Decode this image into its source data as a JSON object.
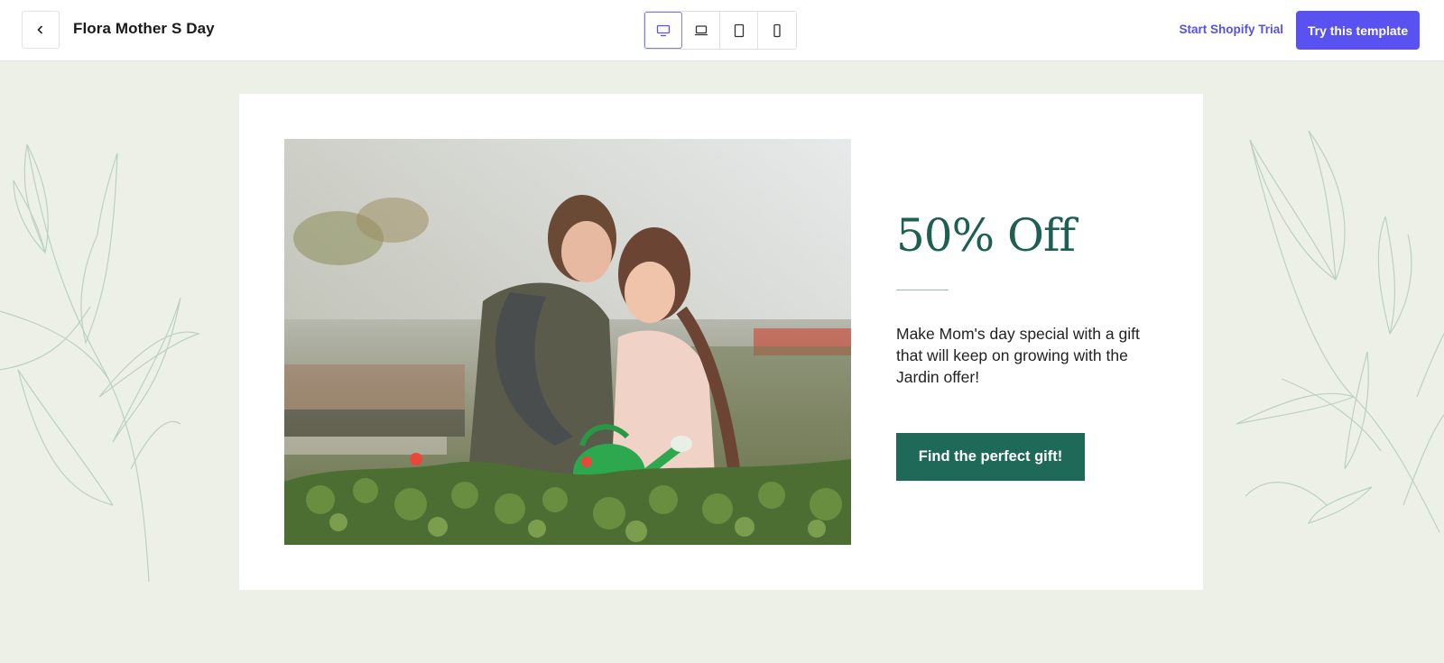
{
  "topbar": {
    "title": "Flora Mother S Day",
    "start_trial_label": "Start Shopify Trial",
    "try_template_label": "Try this template",
    "devices": [
      "desktop",
      "laptop",
      "tablet",
      "mobile"
    ],
    "active_device": "desktop"
  },
  "hero": {
    "headline": "50% Off",
    "description": "Make Mom's day special with a gift that will keep on growing with the Jardin offer!",
    "cta_label": "Find the perfect gift!",
    "image_alt": "mother-and-daughter-watering-plants"
  },
  "colors": {
    "background": "#edf0e7",
    "accent": "#5a52f0",
    "brand_green": "#1f6958",
    "headline_green": "#1f5e52"
  }
}
